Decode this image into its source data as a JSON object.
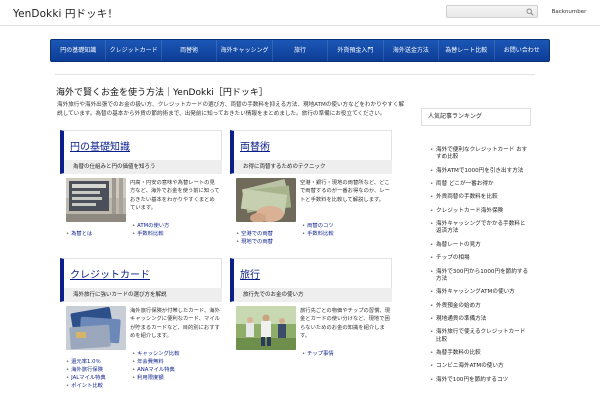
{
  "header": {
    "site_title": "YenDokki 円ドッキ！",
    "search_placeholder": "",
    "backnumber_label": "Backnumber"
  },
  "nav": [
    "円の基礎知識",
    "クレジットカード",
    "両替術",
    "海外キャッシング",
    "旅行",
    "外貨預金入門",
    "海外送金方法",
    "為替レート比較",
    "お問い合わせ"
  ],
  "main": {
    "heading": "海外で賢くお金を使う方法｜YenDokki［円ドッキ］",
    "intro": "海外旅行や海外出張でのお金の扱い方、クレジットカードの選び方、両替の手数料を抑える方法、現地ATMの使い方などをわかりやすく解説しています。為替の基本から外貨の節約術まで、出発前に知っておきたい情報をまとめました。旅行の準備にお役立てください。",
    "cards": [
      {
        "title": "円の基礎知識",
        "subtitle": "為替の仕組みと円の価値を知ろう",
        "description": "円高・円安の意味や為替レートの見方など、海外でお金を使う前に知っておきたい基本をわかりやすくまとめています。",
        "links_left": [
          "為替とは"
        ],
        "links_right": [
          "ATMの使い方",
          "手数料比較"
        ]
      },
      {
        "title": "両替術",
        "subtitle": "お得に両替するためのテクニック",
        "description": "空港・銀行・現地の両替所など、どこで両替するのが一番お得なのか、レートと手数料を比較して解説します。",
        "links_left": [
          "空港での両替",
          "現地での両替"
        ],
        "links_right": [
          "両替のコツ",
          "手数料比較"
        ]
      },
      {
        "title": "クレジットカード",
        "subtitle": "海外旅行に強いカードの選び方を解説",
        "description": "海外旅行保険が付帯したカード、海外キャッシングに便利なカード、マイルが貯まるカードなど、目的別におすすめを紹介します。",
        "links_left": [
          "還元率1.0％",
          "海外旅行保険",
          "JALマイル特典",
          "ポイント比較"
        ],
        "links_right": [
          "キャッシング比較",
          "年会費無料",
          "ANAマイル特典",
          "利用限度額"
        ]
      },
      {
        "title": "旅行",
        "subtitle": "旅行先でのお金の使い方",
        "description": "旅行先ごとの物価やチップの習慣、現金とカードの使い分けなど、現地で困らないためのお金の知識を紹介します。",
        "links_left": [],
        "links_right": [
          "チップ事情"
        ]
      }
    ]
  },
  "sidebar": {
    "heading": "人気記事ランキング",
    "items": [
      "海外で便利なクレジットカード おすすめ比較",
      "海外ATMで1000円を引き出す方法",
      "両替 どこが一番お得か",
      "外貨両替の手数料を比較",
      "クレジットカード海外保険",
      "海外キャッシングでかかる手数料と返済方法",
      "為替レートの見方",
      "チップの相場",
      "海外で300円から1000円を節約する方法",
      "海外キャッシングATMの使い方",
      "外貨預金の始め方",
      "現地通貨の準備方法",
      "海外旅行で使えるクレジットカード比較",
      "為替手数料の比較",
      "コンビニ海外ATMの使い方",
      "海外で100円を節約するコツ"
    ]
  },
  "colors": {
    "nav_bg": "#1c57b6",
    "accent": "#0b1f8c"
  }
}
